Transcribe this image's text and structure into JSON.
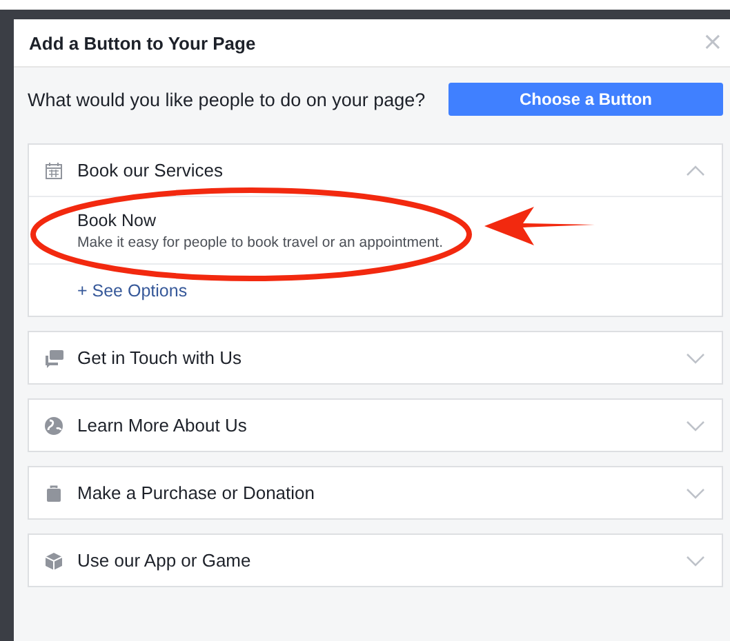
{
  "dialog": {
    "title": "Add a Button to Your Page",
    "close": "×"
  },
  "prompt": "What would you like people to do on your page?",
  "primary_button": "Choose a Button",
  "sections": [
    {
      "label": "Book our Services",
      "expanded": true,
      "options": [
        {
          "title": "Book Now",
          "description": "Make it easy for people to book travel or an appointment.",
          "circled": true
        }
      ],
      "more_link": "+ See Options"
    },
    {
      "label": "Get in Touch with Us",
      "expanded": false
    },
    {
      "label": "Learn More About Us",
      "expanded": false
    },
    {
      "label": "Make a Purchase or Donation",
      "expanded": false
    },
    {
      "label": "Use our App or Game",
      "expanded": false
    }
  ]
}
